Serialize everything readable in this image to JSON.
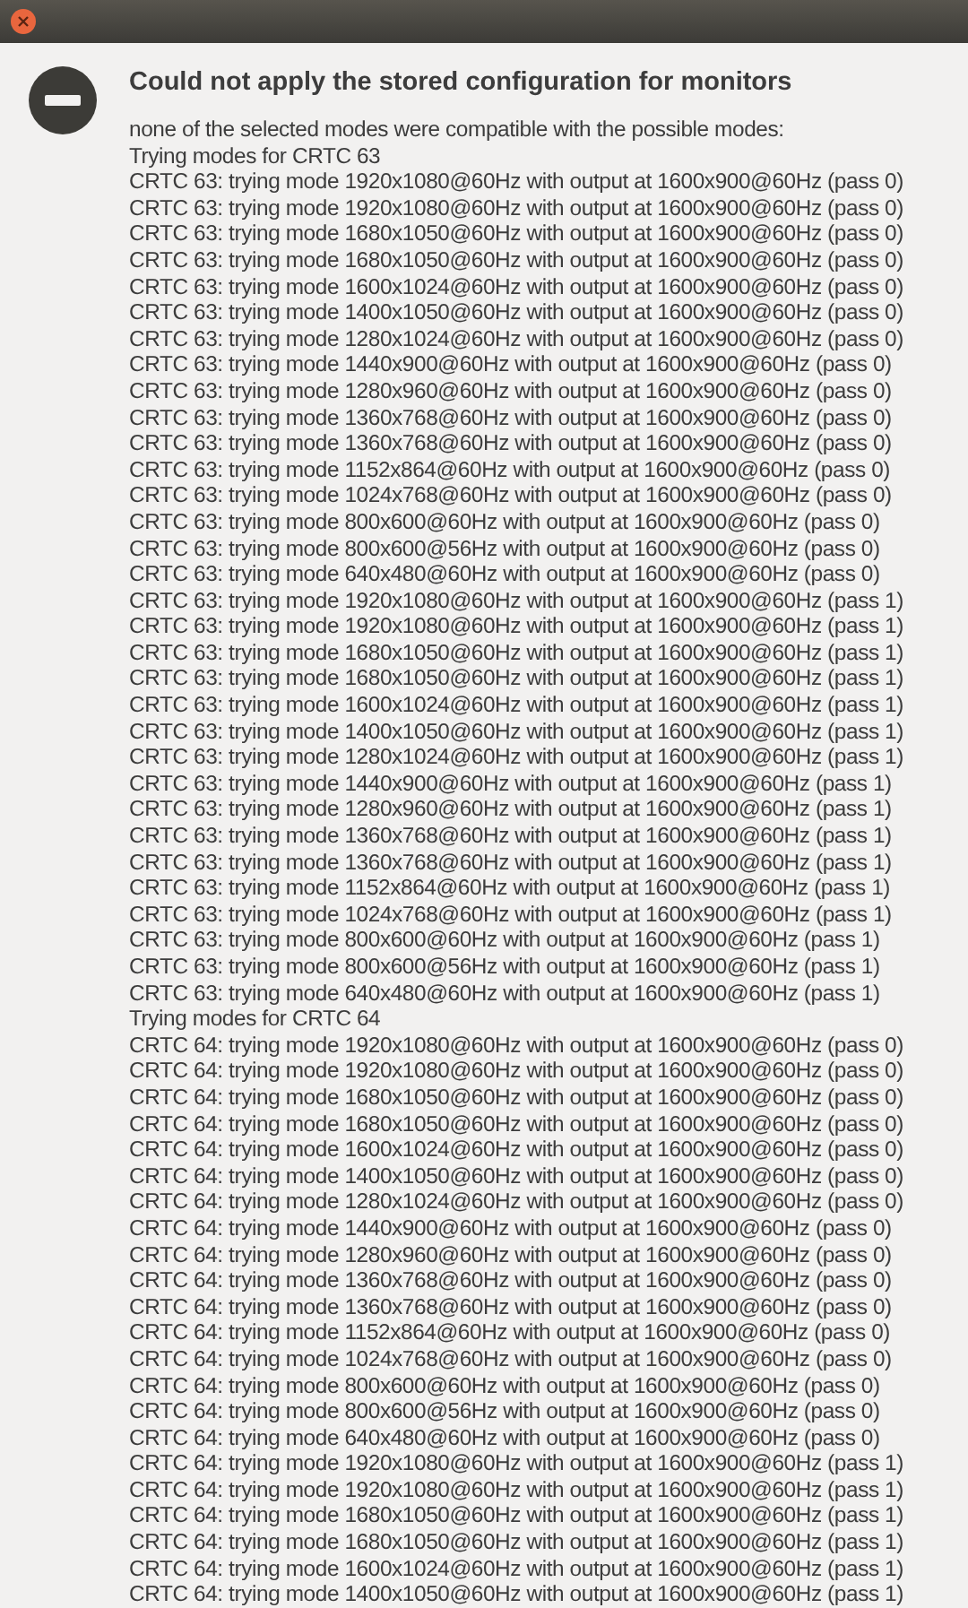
{
  "dialog": {
    "title": "Could not apply the stored configuration for monitors",
    "lines": [
      "none of the selected modes were compatible with the possible modes:",
      "Trying modes for CRTC 63",
      "CRTC 63: trying mode 1920x1080@60Hz with output at 1600x900@60Hz (pass 0)",
      "CRTC 63: trying mode 1920x1080@60Hz with output at 1600x900@60Hz (pass 0)",
      "CRTC 63: trying mode 1680x1050@60Hz with output at 1600x900@60Hz (pass 0)",
      "CRTC 63: trying mode 1680x1050@60Hz with output at 1600x900@60Hz (pass 0)",
      "CRTC 63: trying mode 1600x1024@60Hz with output at 1600x900@60Hz (pass 0)",
      "CRTC 63: trying mode 1400x1050@60Hz with output at 1600x900@60Hz (pass 0)",
      "CRTC 63: trying mode 1280x1024@60Hz with output at 1600x900@60Hz (pass 0)",
      "CRTC 63: trying mode 1440x900@60Hz with output at 1600x900@60Hz (pass 0)",
      "CRTC 63: trying mode 1280x960@60Hz with output at 1600x900@60Hz (pass 0)",
      "CRTC 63: trying mode 1360x768@60Hz with output at 1600x900@60Hz (pass 0)",
      "CRTC 63: trying mode 1360x768@60Hz with output at 1600x900@60Hz (pass 0)",
      "CRTC 63: trying mode 1152x864@60Hz with output at 1600x900@60Hz (pass 0)",
      "CRTC 63: trying mode 1024x768@60Hz with output at 1600x900@60Hz (pass 0)",
      "CRTC 63: trying mode 800x600@60Hz with output at 1600x900@60Hz (pass 0)",
      "CRTC 63: trying mode 800x600@56Hz with output at 1600x900@60Hz (pass 0)",
      "CRTC 63: trying mode 640x480@60Hz with output at 1600x900@60Hz (pass 0)",
      "CRTC 63: trying mode 1920x1080@60Hz with output at 1600x900@60Hz (pass 1)",
      "CRTC 63: trying mode 1920x1080@60Hz with output at 1600x900@60Hz (pass 1)",
      "CRTC 63: trying mode 1680x1050@60Hz with output at 1600x900@60Hz (pass 1)",
      "CRTC 63: trying mode 1680x1050@60Hz with output at 1600x900@60Hz (pass 1)",
      "CRTC 63: trying mode 1600x1024@60Hz with output at 1600x900@60Hz (pass 1)",
      "CRTC 63: trying mode 1400x1050@60Hz with output at 1600x900@60Hz (pass 1)",
      "CRTC 63: trying mode 1280x1024@60Hz with output at 1600x900@60Hz (pass 1)",
      "CRTC 63: trying mode 1440x900@60Hz with output at 1600x900@60Hz (pass 1)",
      "CRTC 63: trying mode 1280x960@60Hz with output at 1600x900@60Hz (pass 1)",
      "CRTC 63: trying mode 1360x768@60Hz with output at 1600x900@60Hz (pass 1)",
      "CRTC 63: trying mode 1360x768@60Hz with output at 1600x900@60Hz (pass 1)",
      "CRTC 63: trying mode 1152x864@60Hz with output at 1600x900@60Hz (pass 1)",
      "CRTC 63: trying mode 1024x768@60Hz with output at 1600x900@60Hz (pass 1)",
      "CRTC 63: trying mode 800x600@60Hz with output at 1600x900@60Hz (pass 1)",
      "CRTC 63: trying mode 800x600@56Hz with output at 1600x900@60Hz (pass 1)",
      "CRTC 63: trying mode 640x480@60Hz with output at 1600x900@60Hz (pass 1)",
      "Trying modes for CRTC 64",
      "CRTC 64: trying mode 1920x1080@60Hz with output at 1600x900@60Hz (pass 0)",
      "CRTC 64: trying mode 1920x1080@60Hz with output at 1600x900@60Hz (pass 0)",
      "CRTC 64: trying mode 1680x1050@60Hz with output at 1600x900@60Hz (pass 0)",
      "CRTC 64: trying mode 1680x1050@60Hz with output at 1600x900@60Hz (pass 0)",
      "CRTC 64: trying mode 1600x1024@60Hz with output at 1600x900@60Hz (pass 0)",
      "CRTC 64: trying mode 1400x1050@60Hz with output at 1600x900@60Hz (pass 0)",
      "CRTC 64: trying mode 1280x1024@60Hz with output at 1600x900@60Hz (pass 0)",
      "CRTC 64: trying mode 1440x900@60Hz with output at 1600x900@60Hz (pass 0)",
      "CRTC 64: trying mode 1280x960@60Hz with output at 1600x900@60Hz (pass 0)",
      "CRTC 64: trying mode 1360x768@60Hz with output at 1600x900@60Hz (pass 0)",
      "CRTC 64: trying mode 1360x768@60Hz with output at 1600x900@60Hz (pass 0)",
      "CRTC 64: trying mode 1152x864@60Hz with output at 1600x900@60Hz (pass 0)",
      "CRTC 64: trying mode 1024x768@60Hz with output at 1600x900@60Hz (pass 0)",
      "CRTC 64: trying mode 800x600@60Hz with output at 1600x900@60Hz (pass 0)",
      "CRTC 64: trying mode 800x600@56Hz with output at 1600x900@60Hz (pass 0)",
      "CRTC 64: trying mode 640x480@60Hz with output at 1600x900@60Hz (pass 0)",
      "CRTC 64: trying mode 1920x1080@60Hz with output at 1600x900@60Hz (pass 1)",
      "CRTC 64: trying mode 1920x1080@60Hz with output at 1600x900@60Hz (pass 1)",
      "CRTC 64: trying mode 1680x1050@60Hz with output at 1600x900@60Hz (pass 1)",
      "CRTC 64: trying mode 1680x1050@60Hz with output at 1600x900@60Hz (pass 1)",
      "CRTC 64: trying mode 1600x1024@60Hz with output at 1600x900@60Hz (pass 1)",
      "CRTC 64: trying mode 1400x1050@60Hz with output at 1600x900@60Hz (pass 1)"
    ]
  }
}
